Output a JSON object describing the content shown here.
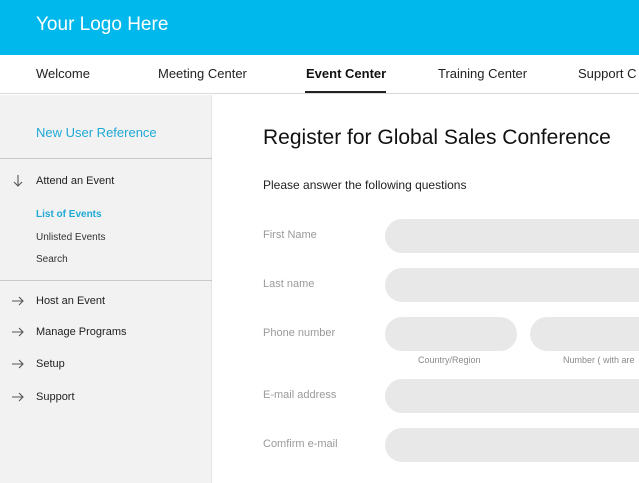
{
  "header": {
    "logo": "Your Logo Here"
  },
  "nav": {
    "tabs": [
      {
        "label": "Welcome"
      },
      {
        "label": "Meeting Center"
      },
      {
        "label": "Event Center"
      },
      {
        "label": "Training Center"
      },
      {
        "label": "Support C"
      }
    ],
    "active": "Event Center"
  },
  "sidebar": {
    "reference_link": "New User Reference",
    "attend": "Attend an Event",
    "subitems": [
      {
        "label": "List of Events",
        "active": true
      },
      {
        "label": "Unlisted Events",
        "active": false
      },
      {
        "label": "Search",
        "active": false
      }
    ],
    "items": [
      {
        "label": "Host an Event"
      },
      {
        "label": "Manage Programs"
      },
      {
        "label": "Setup"
      },
      {
        "label": "Support"
      }
    ]
  },
  "main": {
    "title": "Register for Global Sales Conference",
    "instructions": "Please answer the following questions",
    "fields": {
      "first_name": {
        "label": "First Name",
        "value": ""
      },
      "last_name": {
        "label": "Last name",
        "value": ""
      },
      "phone": {
        "label": "Phone number",
        "country_hint": "Country/Region",
        "number_hint": "Number ( with are"
      },
      "email": {
        "label": "E-mail address",
        "value": ""
      },
      "confirm_email": {
        "label": "Comfirm e-mail",
        "value": ""
      }
    }
  },
  "colors": {
    "brand": "#00b8eb",
    "link": "#1fa9d6",
    "field_bg": "#e8e8e8",
    "sidebar_bg": "#f2f2f2"
  },
  "icons": {
    "expanded": "arrow-down-icon",
    "collapsed": "arrow-right-icon"
  }
}
